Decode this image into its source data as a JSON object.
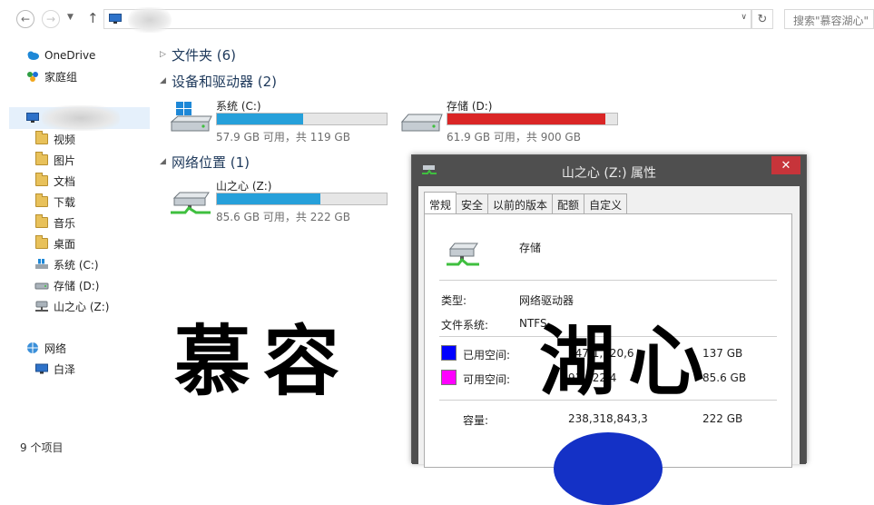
{
  "toolbar": {
    "back_icon": "back-arrow-icon",
    "forward_icon": "forward-arrow-icon",
    "up_icon": "up-arrow-icon",
    "refresh_icon": "refresh-icon",
    "search_placeholder": "搜索\"慕容湖心\""
  },
  "nav": {
    "items": [
      {
        "label": "OneDrive",
        "icon": "cloud-icon"
      },
      {
        "label": "家庭组",
        "icon": "homegroup-icon"
      }
    ],
    "pc_children": [
      {
        "label": "视频",
        "icon": "video-folder-icon"
      },
      {
        "label": "图片",
        "icon": "pictures-folder-icon"
      },
      {
        "label": "文档",
        "icon": "documents-folder-icon"
      },
      {
        "label": "下载",
        "icon": "downloads-folder-icon"
      },
      {
        "label": "音乐",
        "icon": "music-folder-icon"
      },
      {
        "label": "桌面",
        "icon": "desktop-folder-icon"
      },
      {
        "label": "系统 (C:)",
        "icon": "system-drive-icon"
      },
      {
        "label": "存储 (D:)",
        "icon": "drive-icon"
      },
      {
        "label": "山之心 (Z:)",
        "icon": "network-drive-icon"
      }
    ],
    "network": {
      "label": "网络",
      "icon": "network-icon"
    },
    "network_child": {
      "label": "白泽",
      "icon": "computer-icon"
    }
  },
  "status": {
    "item_count": "9 个项目"
  },
  "groups": {
    "folders": "文件夹 (6)",
    "devices": "设备和驱动器 (2)",
    "network": "网络位置 (1)"
  },
  "drives": [
    {
      "name": "系统 (C:)",
      "free_text": "57.9 GB 可用，共 119 GB",
      "used_fraction": 0.51,
      "bar_color": "#26a0da"
    },
    {
      "name": "存储 (D:)",
      "free_text": "61.9 GB 可用，共 900 GB",
      "used_fraction": 0.93,
      "bar_color": "#da2626"
    },
    {
      "name": "山之心 (Z:)",
      "free_text": "85.6 GB 可用，共 222 GB",
      "used_fraction": 0.61,
      "bar_color": "#26a0da"
    }
  ],
  "dialog": {
    "title": "山之心 (Z:) 属性",
    "close_icon": "close-icon",
    "tabs": [
      "常规",
      "安全",
      "以前的版本",
      "配额",
      "自定义"
    ],
    "active_tab": "常规",
    "drive_name": "存储",
    "type_label": "类型:",
    "type_value": "网络驱动器",
    "fs_label": "文件系统:",
    "fs_value": "NTFS",
    "used_label": "已用空间:",
    "used_bytes": "147,1,920,6",
    "used_gb": "137 GB",
    "free_label": "可用空间:",
    "free_bytes": "91,922,4",
    "free_gb": "85.6 GB",
    "capacity_label": "容量:",
    "capacity_bytes": "238,318,843,3",
    "capacity_gb": "222 GB",
    "used_color": "#0000ff",
    "free_color": "#ff00ff"
  },
  "seals": {
    "left": "慕容",
    "right": "湖心"
  }
}
